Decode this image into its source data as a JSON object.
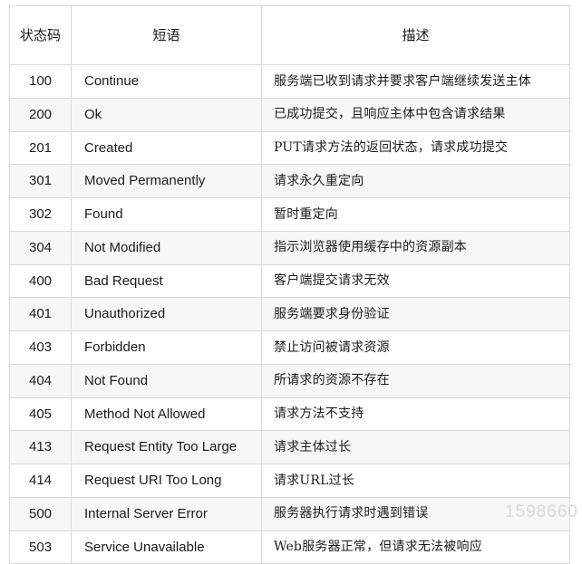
{
  "table": {
    "headers": {
      "code": "状态码",
      "phrase": "短语",
      "description": "描述"
    },
    "rows": [
      {
        "code": "100",
        "phrase": "Continue",
        "description": "服务端已收到请求并要求客户端继续发送主体"
      },
      {
        "code": "200",
        "phrase": "Ok",
        "description": "已成功提交，且响应主体中包含请求结果"
      },
      {
        "code": "201",
        "phrase": "Created",
        "description": "PUT请求方法的返回状态，请求成功提交"
      },
      {
        "code": "301",
        "phrase": "Moved Permanently",
        "description": "请求永久重定向"
      },
      {
        "code": "302",
        "phrase": "Found",
        "description": "暂时重定向"
      },
      {
        "code": "304",
        "phrase": "Not Modified",
        "description": "指示浏览器使用缓存中的资源副本"
      },
      {
        "code": "400",
        "phrase": "Bad Request",
        "description": "客户端提交请求无效"
      },
      {
        "code": "401",
        "phrase": "Unauthorized",
        "description": "服务端要求身份验证"
      },
      {
        "code": "403",
        "phrase": "Forbidden",
        "description": "禁止访问被请求资源"
      },
      {
        "code": "404",
        "phrase": "Not Found",
        "description": "所请求的资源不存在"
      },
      {
        "code": "405",
        "phrase": "Method Not Allowed",
        "description": "请求方法不支持"
      },
      {
        "code": "413",
        "phrase": "Request Entity Too Large",
        "description": "请求主体过长"
      },
      {
        "code": "414",
        "phrase": "Request URI Too Long",
        "description": "请求URL过长"
      },
      {
        "code": "500",
        "phrase": "Internal Server Error",
        "description": "服务器执行请求时遇到错误"
      },
      {
        "code": "503",
        "phrase": "Service Unavailable",
        "description": "Web服务器正常，但请求无法被响应"
      }
    ]
  },
  "watermark": {
    "text": "1598660"
  },
  "colors": {
    "border": "#d9d9d9",
    "stripe": "#f7f7f7",
    "background": "#ffffff",
    "text": "#1b1b1b",
    "watermark": "#d6d9dc"
  }
}
